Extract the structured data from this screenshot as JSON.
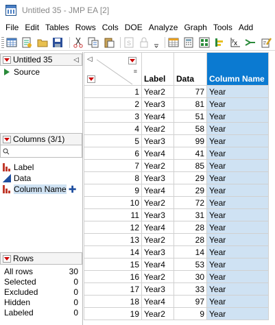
{
  "window": {
    "title": "Untitled 35 - JMP EA [2]"
  },
  "menu": [
    "File",
    "Edit",
    "Tables",
    "Rows",
    "Cols",
    "DOE",
    "Analyze",
    "Graph",
    "Tools",
    "Add"
  ],
  "toolbar": {
    "icons": [
      "new-table-icon",
      "new-script-icon",
      "open-icon",
      "save-icon",
      "cut-icon",
      "copy-icon",
      "paste-icon",
      "copy-disabled-icon",
      "lock-disabled-icon",
      "data-table-icon",
      "calculator-icon",
      "grid-icon",
      "distribution-icon",
      "fit-y-by-x-icon",
      "fit-model-icon",
      "script-icon"
    ]
  },
  "table_panel": {
    "title": "Untitled 35",
    "source_label": "Source"
  },
  "columns_panel": {
    "title": "Columns (3/1)",
    "items": [
      {
        "label": "Label",
        "icon": "nominal-icon"
      },
      {
        "label": "Data",
        "icon": "continuous-icon"
      },
      {
        "label": "Column Name",
        "icon": "nominal-icon",
        "selected": true
      }
    ]
  },
  "rows_panel": {
    "title": "Rows",
    "stats": [
      {
        "label": "All rows",
        "value": "30"
      },
      {
        "label": "Selected",
        "value": "0"
      },
      {
        "label": "Excluded",
        "value": "0"
      },
      {
        "label": "Hidden",
        "value": "0"
      },
      {
        "label": "Labeled",
        "value": "0"
      }
    ]
  },
  "grid": {
    "columns": [
      "Label",
      "Data",
      "Column Name"
    ],
    "rows": [
      [
        "1",
        "Year2",
        "77",
        "Year"
      ],
      [
        "2",
        "Year3",
        "81",
        "Year"
      ],
      [
        "3",
        "Year4",
        "51",
        "Year"
      ],
      [
        "4",
        "Year2",
        "58",
        "Year"
      ],
      [
        "5",
        "Year3",
        "99",
        "Year"
      ],
      [
        "6",
        "Year4",
        "41",
        "Year"
      ],
      [
        "7",
        "Year2",
        "85",
        "Year"
      ],
      [
        "8",
        "Year3",
        "29",
        "Year"
      ],
      [
        "9",
        "Year4",
        "29",
        "Year"
      ],
      [
        "10",
        "Year2",
        "72",
        "Year"
      ],
      [
        "11",
        "Year3",
        "31",
        "Year"
      ],
      [
        "12",
        "Year4",
        "28",
        "Year"
      ],
      [
        "13",
        "Year2",
        "28",
        "Year"
      ],
      [
        "14",
        "Year3",
        "14",
        "Year"
      ],
      [
        "15",
        "Year4",
        "53",
        "Year"
      ],
      [
        "16",
        "Year2",
        "30",
        "Year"
      ],
      [
        "17",
        "Year3",
        "33",
        "Year"
      ],
      [
        "18",
        "Year4",
        "97",
        "Year"
      ],
      [
        "19",
        "Year2",
        "9",
        "Year"
      ]
    ]
  }
}
